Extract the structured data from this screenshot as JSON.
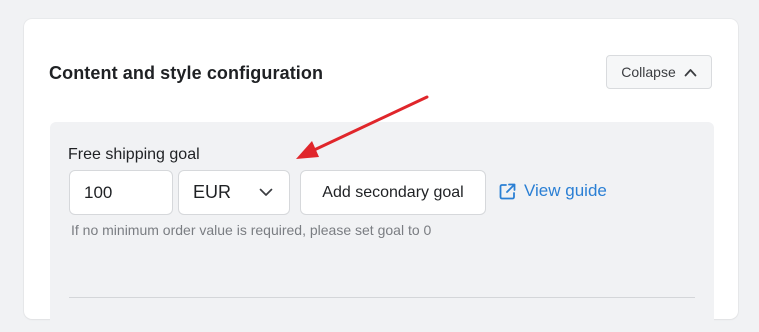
{
  "section": {
    "title": "Content and style configuration",
    "collapse_label": "Collapse"
  },
  "goal": {
    "label": "Free shipping goal",
    "value": "100",
    "currency": "EUR",
    "add_secondary_label": "Add secondary goal",
    "view_guide_label": "View guide",
    "hint": "If no minimum order value is required, please set goal to 0"
  },
  "annotation": {
    "arrow_color": "#e0262b"
  },
  "colors": {
    "link": "#2a7fd4",
    "panel_bg": "#f1f2f4"
  },
  "icons": {
    "collapse": "chevron-up-icon",
    "currency": "chevron-down-icon",
    "guide": "external-link-icon"
  }
}
